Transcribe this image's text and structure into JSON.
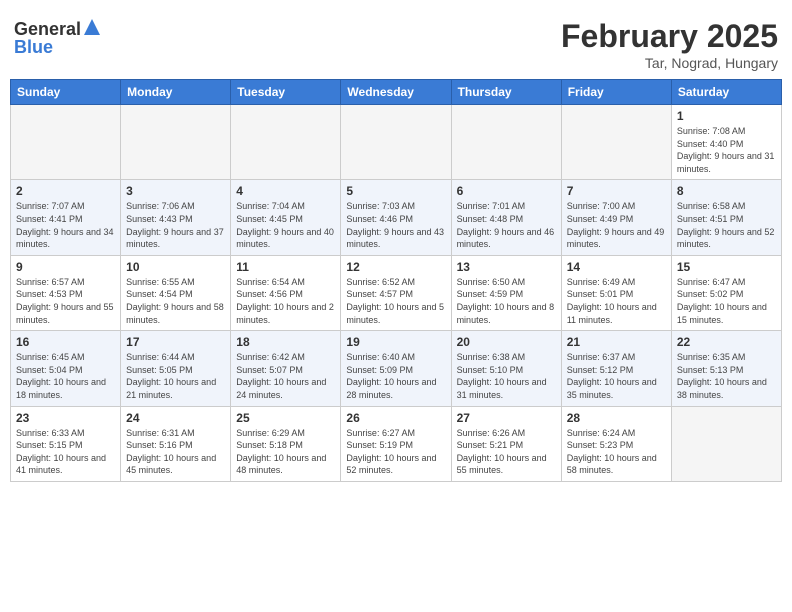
{
  "header": {
    "logo_general": "General",
    "logo_blue": "Blue",
    "month": "February 2025",
    "location": "Tar, Nograd, Hungary"
  },
  "weekdays": [
    "Sunday",
    "Monday",
    "Tuesday",
    "Wednesday",
    "Thursday",
    "Friday",
    "Saturday"
  ],
  "weeks": [
    [
      {
        "day": "",
        "info": ""
      },
      {
        "day": "",
        "info": ""
      },
      {
        "day": "",
        "info": ""
      },
      {
        "day": "",
        "info": ""
      },
      {
        "day": "",
        "info": ""
      },
      {
        "day": "",
        "info": ""
      },
      {
        "day": "1",
        "info": "Sunrise: 7:08 AM\nSunset: 4:40 PM\nDaylight: 9 hours and 31 minutes."
      }
    ],
    [
      {
        "day": "2",
        "info": "Sunrise: 7:07 AM\nSunset: 4:41 PM\nDaylight: 9 hours and 34 minutes."
      },
      {
        "day": "3",
        "info": "Sunrise: 7:06 AM\nSunset: 4:43 PM\nDaylight: 9 hours and 37 minutes."
      },
      {
        "day": "4",
        "info": "Sunrise: 7:04 AM\nSunset: 4:45 PM\nDaylight: 9 hours and 40 minutes."
      },
      {
        "day": "5",
        "info": "Sunrise: 7:03 AM\nSunset: 4:46 PM\nDaylight: 9 hours and 43 minutes."
      },
      {
        "day": "6",
        "info": "Sunrise: 7:01 AM\nSunset: 4:48 PM\nDaylight: 9 hours and 46 minutes."
      },
      {
        "day": "7",
        "info": "Sunrise: 7:00 AM\nSunset: 4:49 PM\nDaylight: 9 hours and 49 minutes."
      },
      {
        "day": "8",
        "info": "Sunrise: 6:58 AM\nSunset: 4:51 PM\nDaylight: 9 hours and 52 minutes."
      }
    ],
    [
      {
        "day": "9",
        "info": "Sunrise: 6:57 AM\nSunset: 4:53 PM\nDaylight: 9 hours and 55 minutes."
      },
      {
        "day": "10",
        "info": "Sunrise: 6:55 AM\nSunset: 4:54 PM\nDaylight: 9 hours and 58 minutes."
      },
      {
        "day": "11",
        "info": "Sunrise: 6:54 AM\nSunset: 4:56 PM\nDaylight: 10 hours and 2 minutes."
      },
      {
        "day": "12",
        "info": "Sunrise: 6:52 AM\nSunset: 4:57 PM\nDaylight: 10 hours and 5 minutes."
      },
      {
        "day": "13",
        "info": "Sunrise: 6:50 AM\nSunset: 4:59 PM\nDaylight: 10 hours and 8 minutes."
      },
      {
        "day": "14",
        "info": "Sunrise: 6:49 AM\nSunset: 5:01 PM\nDaylight: 10 hours and 11 minutes."
      },
      {
        "day": "15",
        "info": "Sunrise: 6:47 AM\nSunset: 5:02 PM\nDaylight: 10 hours and 15 minutes."
      }
    ],
    [
      {
        "day": "16",
        "info": "Sunrise: 6:45 AM\nSunset: 5:04 PM\nDaylight: 10 hours and 18 minutes."
      },
      {
        "day": "17",
        "info": "Sunrise: 6:44 AM\nSunset: 5:05 PM\nDaylight: 10 hours and 21 minutes."
      },
      {
        "day": "18",
        "info": "Sunrise: 6:42 AM\nSunset: 5:07 PM\nDaylight: 10 hours and 24 minutes."
      },
      {
        "day": "19",
        "info": "Sunrise: 6:40 AM\nSunset: 5:09 PM\nDaylight: 10 hours and 28 minutes."
      },
      {
        "day": "20",
        "info": "Sunrise: 6:38 AM\nSunset: 5:10 PM\nDaylight: 10 hours and 31 minutes."
      },
      {
        "day": "21",
        "info": "Sunrise: 6:37 AM\nSunset: 5:12 PM\nDaylight: 10 hours and 35 minutes."
      },
      {
        "day": "22",
        "info": "Sunrise: 6:35 AM\nSunset: 5:13 PM\nDaylight: 10 hours and 38 minutes."
      }
    ],
    [
      {
        "day": "23",
        "info": "Sunrise: 6:33 AM\nSunset: 5:15 PM\nDaylight: 10 hours and 41 minutes."
      },
      {
        "day": "24",
        "info": "Sunrise: 6:31 AM\nSunset: 5:16 PM\nDaylight: 10 hours and 45 minutes."
      },
      {
        "day": "25",
        "info": "Sunrise: 6:29 AM\nSunset: 5:18 PM\nDaylight: 10 hours and 48 minutes."
      },
      {
        "day": "26",
        "info": "Sunrise: 6:27 AM\nSunset: 5:19 PM\nDaylight: 10 hours and 52 minutes."
      },
      {
        "day": "27",
        "info": "Sunrise: 6:26 AM\nSunset: 5:21 PM\nDaylight: 10 hours and 55 minutes."
      },
      {
        "day": "28",
        "info": "Sunrise: 6:24 AM\nSunset: 5:23 PM\nDaylight: 10 hours and 58 minutes."
      },
      {
        "day": "",
        "info": ""
      }
    ]
  ]
}
